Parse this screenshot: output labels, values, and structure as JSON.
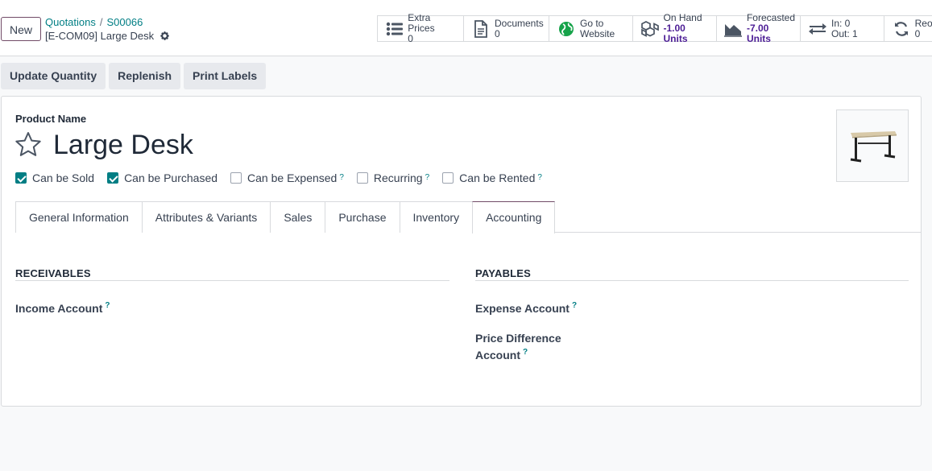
{
  "control_panel": {
    "new_label": "New",
    "breadcrumb": {
      "parent": "Quotations",
      "separator": "/",
      "current": "S00066"
    },
    "record_name": "[E-COM09] Large Desk"
  },
  "stat_buttons": [
    {
      "label": "Extra Prices",
      "value": "0",
      "icon": "list-icon"
    },
    {
      "label": "Documents",
      "value": "0",
      "icon": "document-icon"
    },
    {
      "label": "Go to",
      "value": "Website",
      "icon": "globe-icon"
    },
    {
      "label": "On Hand",
      "value": "-1.00 Units",
      "icon": "cubes-icon"
    },
    {
      "label": "Forecasted",
      "value": "-7.00 Units",
      "icon": "area-chart-icon"
    },
    {
      "label": "In: 0",
      "value": "Out: 1",
      "icon": "exchange-icon"
    },
    {
      "label": "Reordering",
      "value": "0",
      "icon": "refresh-icon"
    }
  ],
  "actions": [
    "Update Quantity",
    "Replenish",
    "Print Labels"
  ],
  "form": {
    "product_name_label": "Product Name",
    "product_name": "Large Desk",
    "checkboxes": [
      {
        "label": "Can be Sold",
        "checked": true,
        "help": ""
      },
      {
        "label": "Can be Purchased",
        "checked": true,
        "help": ""
      },
      {
        "label": "Can be Expensed",
        "checked": false,
        "help": "?"
      },
      {
        "label": "Recurring",
        "checked": false,
        "help": "?"
      },
      {
        "label": "Can be Rented",
        "checked": false,
        "help": "?"
      }
    ],
    "tabs": [
      "General Information",
      "Attributes & Variants",
      "Sales",
      "Purchase",
      "Inventory",
      "Accounting"
    ],
    "active_tab": "Accounting",
    "receivables": {
      "title": "RECEIVABLES",
      "income_account": "Income Account"
    },
    "payables": {
      "title": "PAYABLES",
      "expense_account": "Expense Account",
      "price_diff_line1": "Price Difference",
      "price_diff_line2": "Account"
    },
    "help_mark": "?"
  },
  "colors": {
    "brand": "#714b67",
    "accent": "#017e84",
    "stat_value": "#4c1d95"
  }
}
